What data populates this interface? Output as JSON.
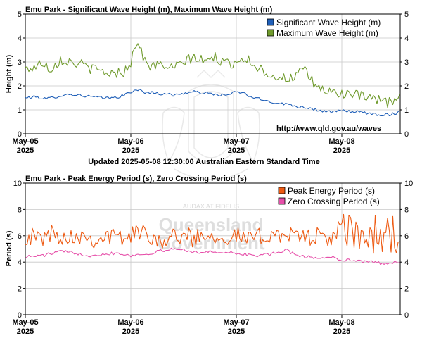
{
  "updated_text": "Updated 2025-05-08 12:30:00 Australian Eastern Standard Time",
  "watermark": {
    "line1": "Queensland",
    "line2": "Government",
    "motto": "AUDAX AT FIDELIS"
  },
  "colors": {
    "significant": "#1f5fb8",
    "maximum": "#6f9a2c",
    "peak": "#ee5a12",
    "zero": "#e64fa9",
    "grid": "#c8c8c8",
    "axis": "#000000"
  },
  "chart_data": [
    {
      "type": "line",
      "title": "Emu Park - Significant Wave Height (m), Maximum Wave Height (m)",
      "ylabel": "Height (m)",
      "ylim": [
        0,
        5
      ],
      "yticks": [
        "0",
        "1",
        "2",
        "3",
        "4",
        "5"
      ],
      "yticks_right": [
        "0",
        "1",
        "2",
        "3",
        "4",
        "5"
      ],
      "xlim_days": [
        0,
        80
      ],
      "xticks": [
        {
          "month": "May-05",
          "year": "2025",
          "day": 0
        },
        {
          "month": "May-06",
          "year": "2025",
          "day": 30
        },
        {
          "month": "May-07",
          "year": "2025",
          "day": 60
        },
        {
          "month": "May-08",
          "year": "2025",
          "day": 90
        }
      ],
      "grid": true,
      "legend": "top-right",
      "url_label": "http://www.qld.gov.au/waves",
      "series": [
        {
          "name": "Significant Wave Height (m)",
          "color_key": "significant",
          "anchors": [
            [
              0,
              1.5
            ],
            [
              3,
              1.55
            ],
            [
              6,
              1.45
            ],
            [
              10,
              1.6
            ],
            [
              13,
              1.65
            ],
            [
              16,
              1.6
            ],
            [
              19,
              1.55
            ],
            [
              22,
              1.5
            ],
            [
              25,
              1.5
            ],
            [
              28,
              1.6
            ],
            [
              30,
              1.75
            ],
            [
              32,
              1.85
            ],
            [
              34,
              1.7
            ],
            [
              36,
              1.75
            ],
            [
              38,
              1.65
            ],
            [
              40,
              1.7
            ],
            [
              42,
              1.6
            ],
            [
              45,
              1.7
            ],
            [
              48,
              1.75
            ],
            [
              51,
              1.7
            ],
            [
              54,
              1.65
            ],
            [
              57,
              1.6
            ],
            [
              60,
              1.75
            ],
            [
              62,
              1.7
            ],
            [
              65,
              1.5
            ],
            [
              68,
              1.4
            ],
            [
              71,
              1.3
            ],
            [
              74,
              1.25
            ],
            [
              77,
              1.15
            ],
            [
              80,
              1.1
            ],
            [
              83,
              1.0
            ],
            [
              86,
              0.9
            ],
            [
              89,
              0.95
            ],
            [
              92,
              0.95
            ],
            [
              95,
              0.9
            ],
            [
              98,
              0.85
            ],
            [
              101,
              0.8
            ],
            [
              104,
              0.8
            ],
            [
              107,
              0.95
            ]
          ],
          "jitter": 0.06
        },
        {
          "name": "Maximum Wave Height (m)",
          "color_key": "maximum",
          "anchors": [
            [
              0,
              2.7
            ],
            [
              3,
              2.8
            ],
            [
              5,
              3.0
            ],
            [
              7,
              2.7
            ],
            [
              10,
              3.1
            ],
            [
              13,
              3.0
            ],
            [
              16,
              2.9
            ],
            [
              19,
              2.7
            ],
            [
              22,
              2.6
            ],
            [
              25,
              2.5
            ],
            [
              28,
              2.6
            ],
            [
              30,
              3.0
            ],
            [
              32,
              3.95
            ],
            [
              34,
              3.0
            ],
            [
              36,
              2.8
            ],
            [
              39,
              2.9
            ],
            [
              42,
              2.7
            ],
            [
              45,
              3.0
            ],
            [
              48,
              3.2
            ],
            [
              51,
              3.0
            ],
            [
              54,
              3.2
            ],
            [
              57,
              2.9
            ],
            [
              60,
              3.0
            ],
            [
              62,
              3.2
            ],
            [
              65,
              2.9
            ],
            [
              68,
              2.6
            ],
            [
              71,
              2.4
            ],
            [
              74,
              2.3
            ],
            [
              77,
              2.4
            ],
            [
              79,
              2.7
            ],
            [
              82,
              2.1
            ],
            [
              85,
              1.8
            ],
            [
              88,
              1.7
            ],
            [
              91,
              1.7
            ],
            [
              94,
              1.6
            ],
            [
              97,
              1.5
            ],
            [
              100,
              1.4
            ],
            [
              103,
              1.3
            ],
            [
              105,
              1.4
            ],
            [
              107,
              1.55
            ]
          ],
          "jitter": 0.22
        }
      ]
    },
    {
      "type": "line",
      "title": "Emu Park - Peak Energy Period (s), Zero Crossing Period (s)",
      "ylabel": "Period (s)",
      "ylim": [
        0,
        10
      ],
      "yticks": [
        "0",
        "2",
        "4",
        "6",
        "8",
        "10"
      ],
      "yticks_right": [
        "0",
        "2",
        "4",
        "6",
        "8",
        "10"
      ],
      "xticks": [
        {
          "month": "May-05",
          "year": "2025",
          "day": 0
        },
        {
          "month": "May-06",
          "year": "2025",
          "day": 30
        },
        {
          "month": "May-07",
          "year": "2025",
          "day": 60
        },
        {
          "month": "May-08",
          "year": "2025",
          "day": 90
        }
      ],
      "grid": true,
      "legend": "top-right",
      "series": [
        {
          "name": "Peak Energy Period (s)",
          "color_key": "peak",
          "anchors": [
            [
              0,
              6.0
            ],
            [
              4,
              5.8
            ],
            [
              8,
              6.2
            ],
            [
              12,
              5.9
            ],
            [
              16,
              6.1
            ],
            [
              20,
              5.7
            ],
            [
              24,
              6.0
            ],
            [
              28,
              5.8
            ],
            [
              32,
              6.3
            ],
            [
              36,
              6.0
            ],
            [
              40,
              5.6
            ],
            [
              44,
              6.1
            ],
            [
              48,
              5.8
            ],
            [
              52,
              6.2
            ],
            [
              56,
              5.9
            ],
            [
              60,
              6.0
            ],
            [
              64,
              5.7
            ],
            [
              68,
              6.0
            ],
            [
              72,
              6.2
            ],
            [
              76,
              5.9
            ],
            [
              80,
              6.0
            ],
            [
              84,
              5.9
            ],
            [
              88,
              5.8
            ],
            [
              92,
              6.3
            ],
            [
              96,
              5.9
            ],
            [
              100,
              6.0
            ],
            [
              104,
              6.2
            ],
            [
              107,
              5.6
            ]
          ],
          "jitter": 0.7,
          "late_jitter_from": 88,
          "late_jitter": 1.6
        },
        {
          "name": "Zero Crossing Period (s)",
          "color_key": "zero",
          "anchors": [
            [
              0,
              4.4
            ],
            [
              5,
              4.5
            ],
            [
              10,
              4.8
            ],
            [
              14,
              4.7
            ],
            [
              18,
              4.5
            ],
            [
              22,
              4.6
            ],
            [
              26,
              4.7
            ],
            [
              30,
              4.5
            ],
            [
              34,
              4.6
            ],
            [
              38,
              4.8
            ],
            [
              42,
              5.0
            ],
            [
              46,
              4.9
            ],
            [
              50,
              4.7
            ],
            [
              54,
              4.8
            ],
            [
              58,
              4.7
            ],
            [
              62,
              4.6
            ],
            [
              66,
              4.5
            ],
            [
              70,
              4.6
            ],
            [
              74,
              4.9
            ],
            [
              78,
              4.5
            ],
            [
              82,
              4.3
            ],
            [
              86,
              4.4
            ],
            [
              90,
              4.2
            ],
            [
              94,
              4.1
            ],
            [
              98,
              4.0
            ],
            [
              102,
              3.9
            ],
            [
              105,
              4.0
            ],
            [
              107,
              4.0
            ]
          ],
          "jitter": 0.12
        }
      ]
    }
  ]
}
